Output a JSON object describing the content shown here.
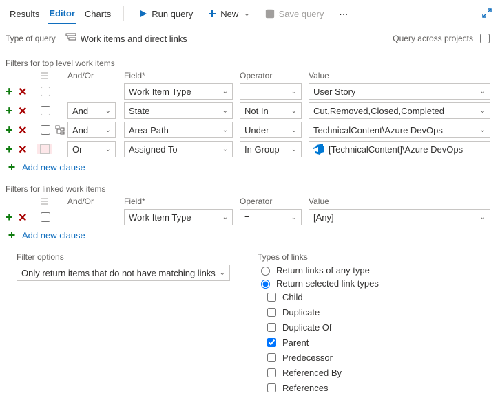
{
  "tabs": {
    "results": "Results",
    "editor": "Editor",
    "charts": "Charts"
  },
  "toolbar": {
    "run": "Run query",
    "new": "New",
    "save": "Save query",
    "more": "···"
  },
  "query_type": {
    "label": "Type of query",
    "value": "Work items and direct links"
  },
  "cross_projects": "Query across projects",
  "headers": {
    "andor": "And/Or",
    "field": "Field*",
    "operator": "Operator",
    "value": "Value"
  },
  "top_caption": "Filters for top level work items",
  "linked_caption": "Filters for linked work items",
  "top": [
    {
      "andor": "",
      "field": "Work Item Type",
      "op": "=",
      "value": "User Story"
    },
    {
      "andor": "And",
      "field": "State",
      "op": "Not In",
      "value": "Cut,Removed,Closed,Completed"
    },
    {
      "andor": "And",
      "field": "Area Path",
      "op": "Under",
      "value": "TechnicalContent\\Azure DevOps"
    },
    {
      "andor": "Or",
      "field": "Assigned To",
      "op": "In Group",
      "value": "[TechnicalContent]\\Azure DevOps"
    }
  ],
  "linked": [
    {
      "andor": "",
      "field": "Work Item Type",
      "op": "=",
      "value": "[Any]"
    }
  ],
  "add_clause": "Add new clause",
  "filter_options": {
    "caption": "Filter options",
    "value": "Only return items that do not have matching links"
  },
  "types_of_links": {
    "caption": "Types of links",
    "any": "Return links of any type",
    "selected": "Return selected link types",
    "items": [
      {
        "label": "Child",
        "checked": false
      },
      {
        "label": "Duplicate",
        "checked": false
      },
      {
        "label": "Duplicate Of",
        "checked": false
      },
      {
        "label": "Parent",
        "checked": true
      },
      {
        "label": "Predecessor",
        "checked": false
      },
      {
        "label": "Referenced By",
        "checked": false
      },
      {
        "label": "References",
        "checked": false
      }
    ]
  }
}
